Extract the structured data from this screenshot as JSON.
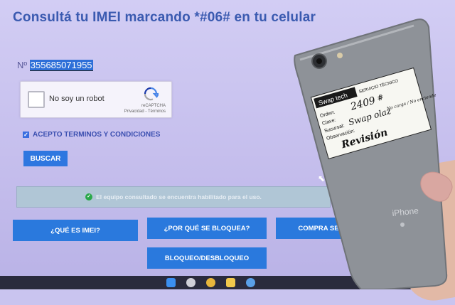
{
  "page": {
    "title": "Consultá tu IMEI marcando *#06# en tu celular",
    "imei_prefix": "Nº",
    "imei_value": "355685071955",
    "captcha": {
      "label": "No soy un robot",
      "brand": "reCAPTCHA",
      "links": "Privacidad - Términos"
    },
    "terms_label": "ACEPTO TERMINOS Y CONDICIONES",
    "search_button": "BUSCAR",
    "result_message": "El equipo consultado se encuentra habilitado para el uso.",
    "buttons": {
      "what_is_imei": "¿QUÉ ES IMEI?",
      "why_blocked": "¿POR QUÉ SE BLOQUEA?",
      "buy_safe": "COMPRA SE",
      "block_unblock": "BLOQUEO/DESBLOQUEO"
    }
  },
  "phone": {
    "brand_text": "iPhone",
    "sticker": {
      "shop": "Swap tech",
      "service": "SERVICIO TÉCNICO",
      "fields": [
        "Orden:",
        "Clave:",
        "Sucursal:",
        "Observación:"
      ],
      "handwriting": [
        "2409",
        "#",
        "Swap olaz",
        "No carga / No enciende",
        "Revisión"
      ]
    }
  },
  "colors": {
    "accent": "#2a79dd",
    "title": "#3a5ab0",
    "phone_body": "#8f9399",
    "alert_bg": "#b0c6d6"
  }
}
